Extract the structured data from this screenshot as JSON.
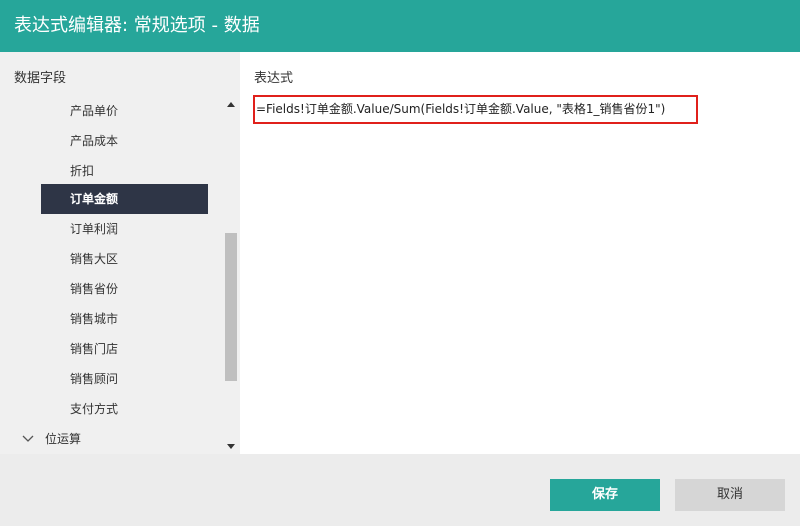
{
  "dialog": {
    "title": "表达式编辑器: 常规选项 - 数据"
  },
  "left": {
    "heading": "数据字段",
    "fields": [
      {
        "label": "产品单价",
        "selected": false
      },
      {
        "label": "产品成本",
        "selected": false
      },
      {
        "label": "折扣",
        "selected": false
      },
      {
        "label": "订单金额",
        "selected": true
      },
      {
        "label": "订单利润",
        "selected": false
      },
      {
        "label": "销售大区",
        "selected": false
      },
      {
        "label": "销售省份",
        "selected": false
      },
      {
        "label": "销售城市",
        "selected": false
      },
      {
        "label": "销售门店",
        "selected": false
      },
      {
        "label": "销售顾问",
        "selected": false
      },
      {
        "label": "支付方式",
        "selected": false
      }
    ],
    "group": {
      "label": "位运算"
    }
  },
  "right": {
    "label": "表达式",
    "expression": "=Fields!订单金额.Value/Sum(Fields!订单金额.Value, \"表格1_销售省份1\")"
  },
  "footer": {
    "save_label": "保存",
    "cancel_label": "取消"
  },
  "colors": {
    "accent": "#26a69a",
    "selected_bg": "#2e3546",
    "highlight_border": "#e0201b"
  }
}
